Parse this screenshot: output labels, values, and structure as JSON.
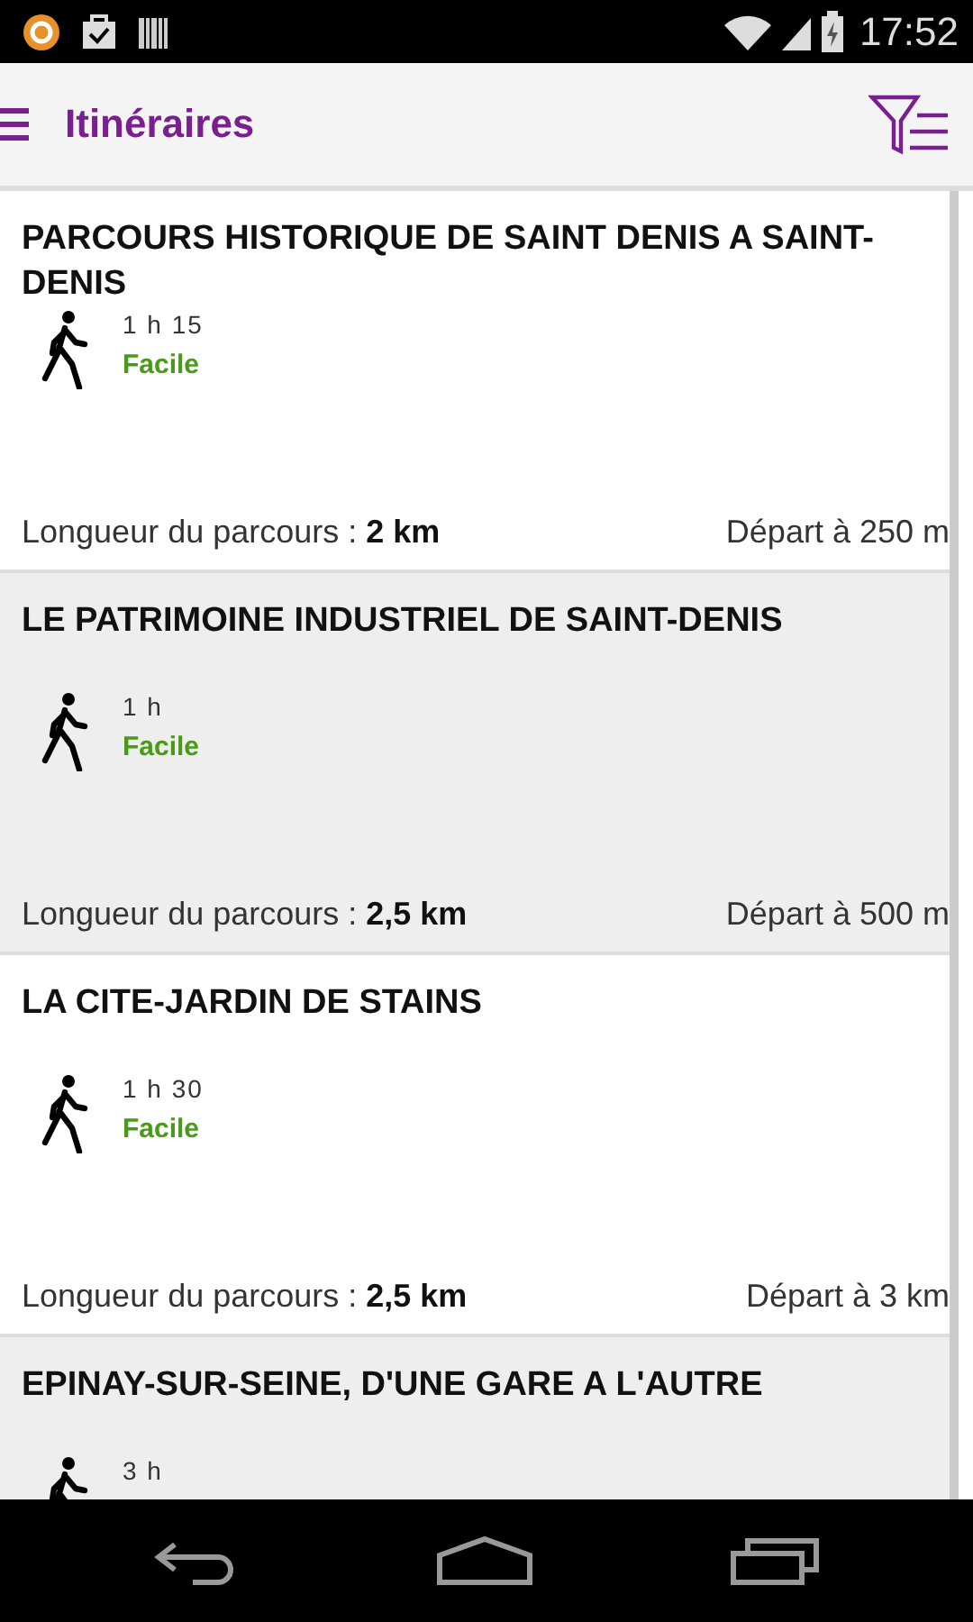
{
  "status_bar": {
    "time": "17:52"
  },
  "app_bar": {
    "title": "Itinéraires"
  },
  "routes": [
    {
      "title": "PARCOURS HISTORIQUE DE SAINT DENIS A SAINT-DENIS",
      "duration": "1 h 15",
      "difficulty": "Facile",
      "length_label": "Longueur du parcours : ",
      "length": "2 km",
      "departure": "Départ à 250 m"
    },
    {
      "title": "LE PATRIMOINE INDUSTRIEL DE SAINT-DENIS",
      "duration": "1 h",
      "difficulty": "Facile",
      "length_label": "Longueur du parcours : ",
      "length": "2,5 km",
      "departure": "Départ à 500 m"
    },
    {
      "title": "LA CITE-JARDIN DE STAINS",
      "duration": "1 h 30",
      "difficulty": "Facile",
      "length_label": "Longueur du parcours : ",
      "length": "2,5 km",
      "departure": "Départ à 3 km"
    },
    {
      "title": "EPINAY-SUR-SEINE, D'UNE GARE A L'AUTRE",
      "duration": "3 h"
    }
  ]
}
